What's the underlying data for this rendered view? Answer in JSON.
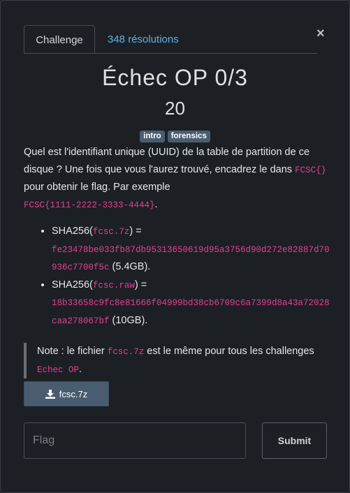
{
  "modal": {
    "close_label": "×",
    "tabs": [
      {
        "label": "Challenge"
      },
      {
        "label": "348 résolutions"
      }
    ]
  },
  "challenge": {
    "title": "Échec OP 0/3",
    "value": "20",
    "tags": [
      "intro",
      "forensics"
    ],
    "description": {
      "intro_1": "Quel est l'identifiant unique (UUID) de la table de partition de ce disque ? Une fois que vous l'aurez trouvé, encadrez le dans ",
      "intro_code": "FCSC{}",
      "intro_2": " pour obtenir le flag. Par exemple ",
      "example_code": "FCSC{1111-2222-3333-4444}",
      "example_end": ".",
      "hashes": [
        {
          "prefix": "SHA256(",
          "file": "fcsc.7z",
          "mid": ") = ",
          "hash": "fe23478be033fb87db95313650619d95a3756d90d272e82887d70936c7700f5c",
          "size": " (5.4GB)."
        },
        {
          "prefix": "SHA256(",
          "file": "fcsc.raw",
          "mid": ") = ",
          "hash": "18b33658c9fc8e81666f04999bd38cb6709c6a7399d8a43a72028caa278067bf",
          "size": " (10GB)."
        }
      ],
      "note_1": "Note : le fichier ",
      "note_code_1": "fcsc.7z",
      "note_2": " est le même pour tous les challenges ",
      "note_code_2": "Echec OP",
      "note_3": "."
    },
    "download": {
      "label": "fcsc.7z",
      "icon": "download-icon"
    },
    "flag_input": {
      "placeholder": "Flag",
      "value": ""
    },
    "submit_label": "Submit"
  },
  "colors": {
    "background": "#1c2025",
    "tag_bg": "#4a5d70",
    "link": "#5fb0e6",
    "code": "#e83e8c"
  }
}
